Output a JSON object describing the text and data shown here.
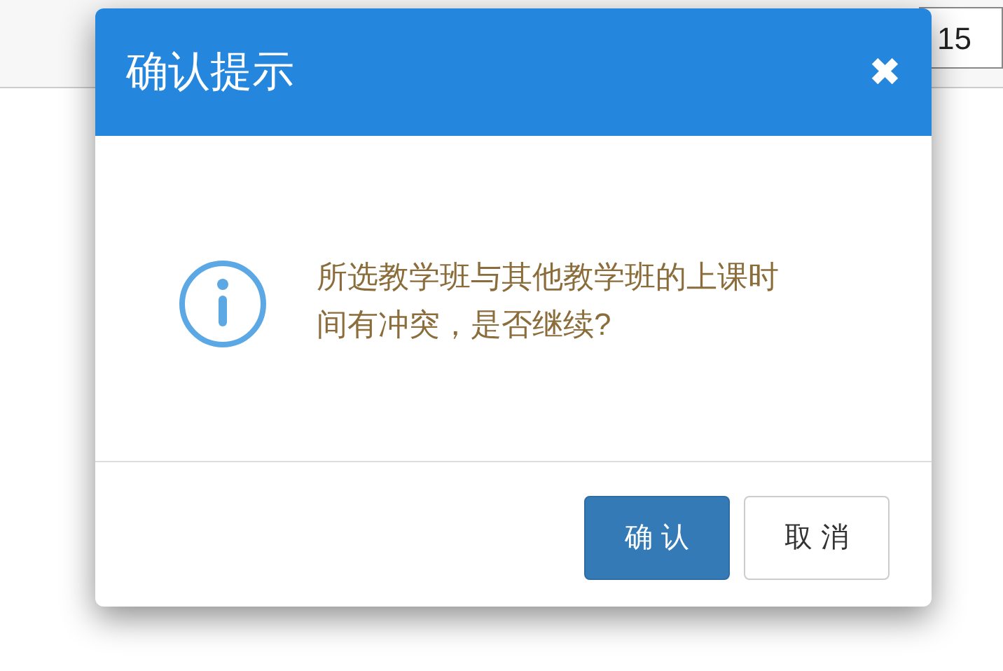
{
  "background": {
    "field_value": "15"
  },
  "dialog": {
    "title": "确认提示",
    "close": "✖",
    "message": "所选教学班与其他教学班的上课时间有冲突，是否继续?",
    "buttons": [
      {
        "label": "确 认",
        "kind": "primary"
      },
      {
        "label": "取 消",
        "kind": "default"
      }
    ]
  }
}
